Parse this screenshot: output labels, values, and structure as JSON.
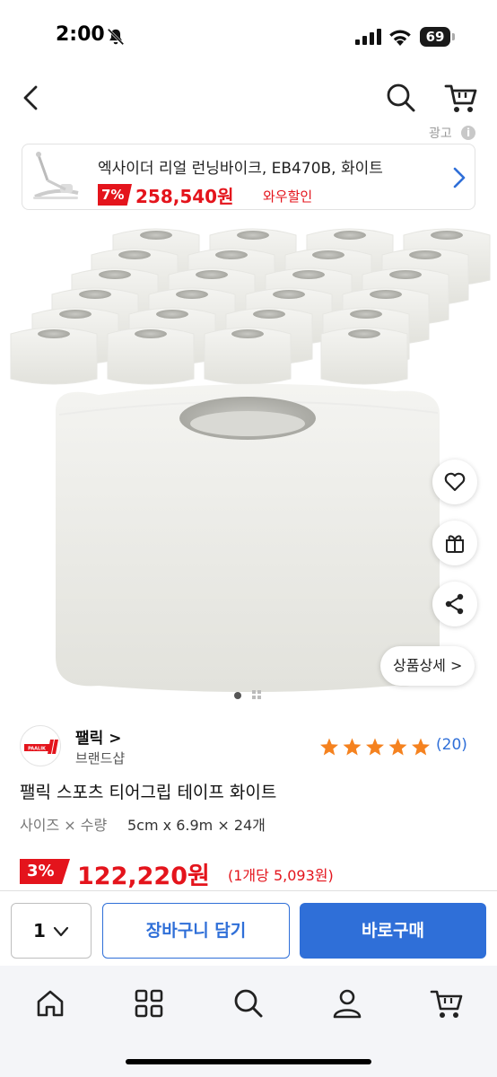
{
  "status_bar": {
    "time": "2:00",
    "battery": "69"
  },
  "header": {
    "back_icon": "chevron-left-icon",
    "search_icon": "search-icon",
    "cart_icon": "cart-icon"
  },
  "ad": {
    "label": "광고",
    "info": "i",
    "title": "엑사이더 리얼 런닝바이크, EB470B, 화이트",
    "discount": "7%",
    "price": "258,540원",
    "sale_label": "와우할인"
  },
  "hero": {
    "detail_button": "상품상세 >",
    "fab_icons": [
      "heart-icon",
      "gift-icon",
      "share-icon"
    ]
  },
  "product": {
    "brand_logo_text": "PAALIK",
    "brand_name": "팰릭 >",
    "brand_sub": "브랜드샵",
    "rating_stars": 5,
    "review_count": "(20)",
    "title": "팰릭 스포츠 티어그립 테이프 화이트",
    "option_label": "사이즈 × 수량",
    "option_value": "5cm x 6.9m × 24개",
    "discount": "3%",
    "price": "122,220원",
    "unit_price": "(1개당 5,093원)"
  },
  "purchase_bar": {
    "quantity": "1",
    "add_to_cart": "장바구니 담기",
    "buy_now": "바로구매"
  },
  "bottom_nav": [
    "home-icon",
    "category-icon",
    "search-icon",
    "mypage-icon",
    "cart-icon"
  ],
  "colors": {
    "accent_blue": "#2f6fd8",
    "sale_red": "#e4141c",
    "star_orange": "#f5821f"
  }
}
